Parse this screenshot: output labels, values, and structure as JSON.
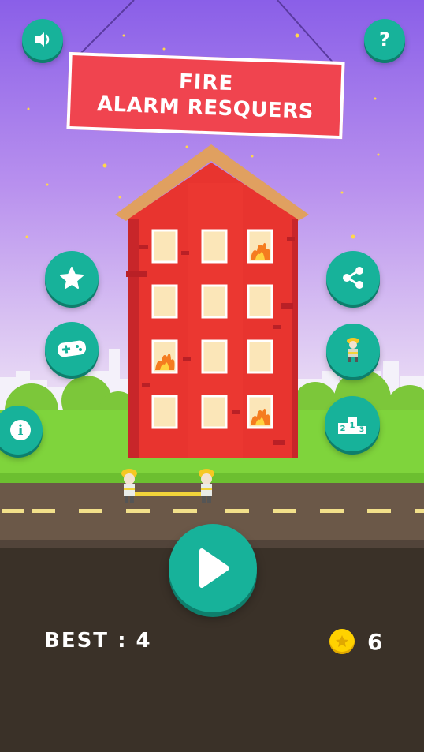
{
  "title": {
    "line1": "FIRE",
    "line2": "ALARM RESQUERS"
  },
  "buttons": {
    "sound": "speaker-icon",
    "help": "?",
    "rate": "star-icon",
    "more_games": "gamepad-icon",
    "info": "i",
    "share": "share-icon",
    "characters": "firefighter-icon",
    "leaderboard": "podium-icon",
    "play": "play-icon"
  },
  "podium": {
    "first": "1",
    "second": "2",
    "third": "3"
  },
  "score": {
    "best_label": "BEST : 4",
    "coins": "6"
  },
  "colors": {
    "accent": "#17b29a",
    "title_bg": "#f0444f",
    "building": "#e8342f",
    "roof": "#e0a060",
    "sky_top": "#8d63ea",
    "sky_bottom": "#e9d8f4",
    "grass": "#7fd43c",
    "road": "#6b5848",
    "ground": "#3a3128",
    "coin": "#ffd200"
  }
}
